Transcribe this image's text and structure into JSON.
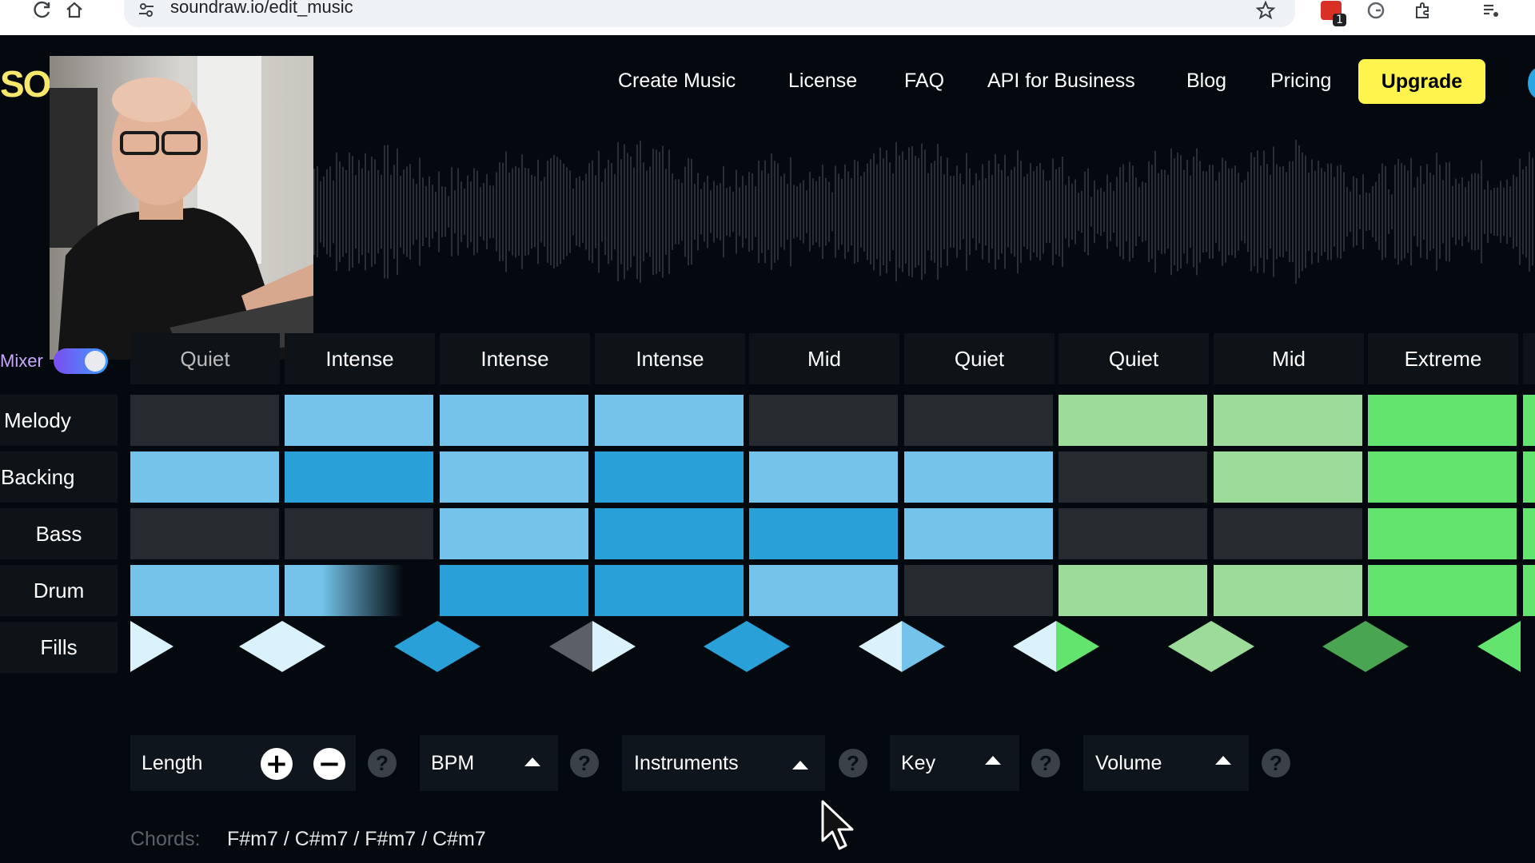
{
  "browser": {
    "url": "soundraw.io/edit_music",
    "icons": [
      "reload-icon",
      "home-icon",
      "site-settings-icon",
      "bookmark-star-icon",
      "extension-badge-icon",
      "extension-icon",
      "extensions-puzzle-icon",
      "media-icon"
    ],
    "badge_count": "1"
  },
  "nav": {
    "logo": "SO",
    "items": [
      "Create Music",
      "License",
      "FAQ",
      "API for Business",
      "Blog",
      "Pricing"
    ],
    "upgrade_label": "Upgrade"
  },
  "mixer": {
    "label": "Mixer",
    "enabled": true
  },
  "sections": [
    "Quiet",
    "Intense",
    "Intense",
    "Intense",
    "Mid",
    "Quiet",
    "Quiet",
    "Mid",
    "Extreme"
  ],
  "tracks": [
    {
      "label": "Melody",
      "cells": [
        "off",
        "light",
        "light",
        "light",
        "off",
        "off",
        "g-light",
        "g-light",
        "g-bright"
      ]
    },
    {
      "label": "Backing",
      "cells": [
        "light",
        "dark",
        "light",
        "dark",
        "light",
        "light",
        "off",
        "g-light",
        "g-bright"
      ]
    },
    {
      "label": "Bass",
      "cells": [
        "off",
        "off",
        "light",
        "dark",
        "dark",
        "light",
        "off",
        "off",
        "g-bright"
      ]
    },
    {
      "label": "Drum",
      "cells": [
        "light",
        "fade",
        "dark",
        "dark",
        "light",
        "off",
        "g-light",
        "g-light",
        "g-bright"
      ]
    }
  ],
  "fills_label": "Fills",
  "controls": {
    "length_label": "Length",
    "bpm_label": "BPM",
    "instruments_label": "Instruments",
    "key_label": "Key",
    "volume_label": "Volume",
    "help_glyph": "?"
  },
  "chords": {
    "label": "Chords:",
    "value": "F#m7 / C#m7 / F#m7 / C#m7"
  },
  "colors": {
    "accent_yellow": "#fff34d",
    "blue_light": "#74c3ea",
    "blue_dark": "#2aa0d8",
    "green_light": "#9ddb9a",
    "green_bright": "#63e46e",
    "cell_off": "#262b2f"
  }
}
